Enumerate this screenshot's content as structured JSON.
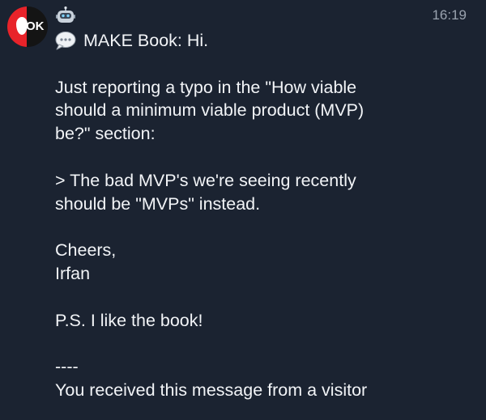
{
  "sender": {
    "avatar_text": "OK",
    "badge_icon": "robot-icon"
  },
  "timestamp": "16:19",
  "message": {
    "prefix_icon": "speech-bubble-icon",
    "first_line": "MAKE Book: Hi.",
    "lines": [
      "",
      "Just reporting a typo in the \"How viable",
      "should a minimum viable product (MVP)",
      "be?\" section:",
      "",
      "> The bad MVP's we're seeing recently",
      "should be \"MVPs\" instead.",
      "",
      "Cheers,",
      "Irfan",
      "",
      "P.S. I like the book!",
      "",
      "----",
      "You received this message from a visitor"
    ]
  }
}
